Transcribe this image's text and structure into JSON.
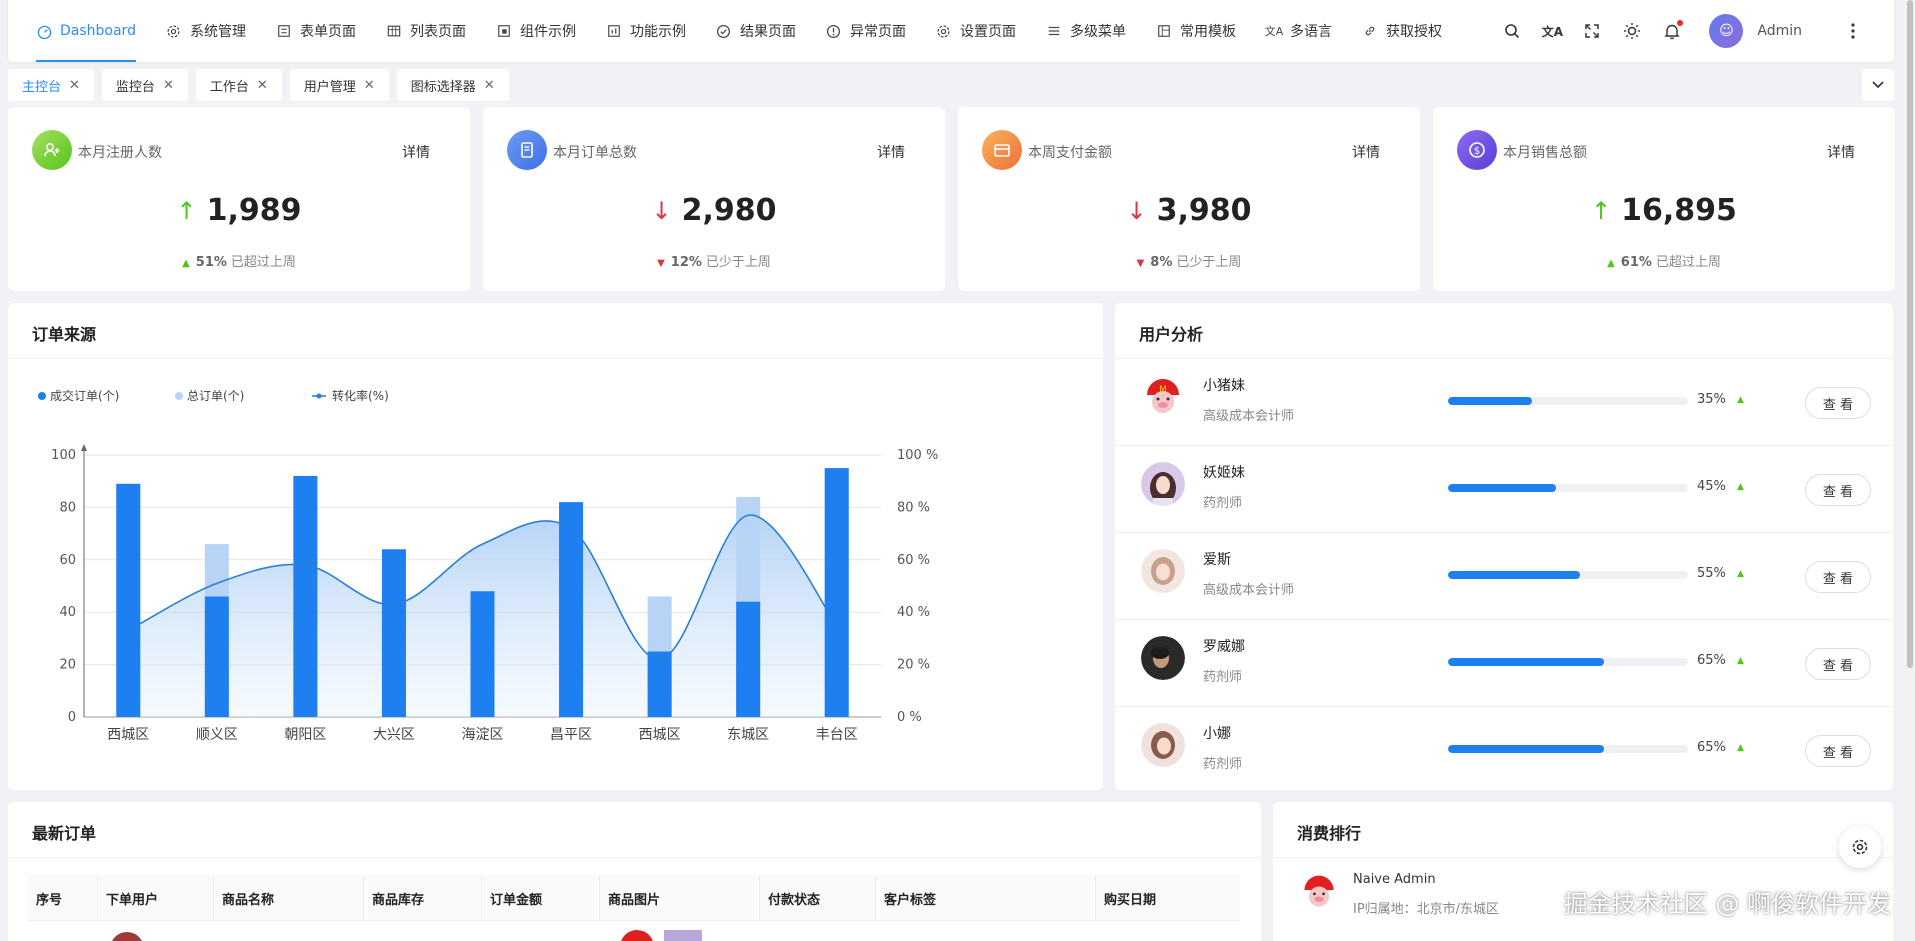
{
  "nav": {
    "items": [
      {
        "label": "Dashboard",
        "icon": "dashboard-icon"
      },
      {
        "label": "系统管理",
        "icon": "gear-icon"
      },
      {
        "label": "表单页面",
        "icon": "form-icon"
      },
      {
        "label": "列表页面",
        "icon": "table-icon"
      },
      {
        "label": "组件示例",
        "icon": "component-icon"
      },
      {
        "label": "功能示例",
        "icon": "feature-icon"
      },
      {
        "label": "结果页面",
        "icon": "check-circle-icon"
      },
      {
        "label": "异常页面",
        "icon": "warning-circle-icon"
      },
      {
        "label": "设置页面",
        "icon": "gear-icon"
      },
      {
        "label": "多级菜单",
        "icon": "menu-icon"
      },
      {
        "label": "常用模板",
        "icon": "template-icon"
      },
      {
        "label": "多语言",
        "icon": "translate-icon"
      },
      {
        "label": "获取授权",
        "icon": "link-icon"
      }
    ],
    "username": "Admin"
  },
  "tabs": [
    "主控台",
    "监控台",
    "工作台",
    "用户管理",
    "图标选择器"
  ],
  "stats": [
    {
      "label": "本月注册人数",
      "detail": "详情",
      "value": "1,989",
      "trend": "up",
      "percent": "51%",
      "compare": "已超过上周",
      "color": "#52c41a"
    },
    {
      "label": "本月订单总数",
      "detail": "详情",
      "value": "2,980",
      "trend": "down",
      "percent": "12%",
      "compare": "已少于上周",
      "color": "#4f7ff0"
    },
    {
      "label": "本周支付金额",
      "detail": "详情",
      "value": "3,980",
      "trend": "down",
      "percent": "8%",
      "compare": "已少于上周",
      "color": "#f0883a"
    },
    {
      "label": "本月销售总额",
      "detail": "详情",
      "value": "16,895",
      "trend": "up",
      "percent": "61%",
      "compare": "已超过上周",
      "color": "#6a4fe0"
    }
  ],
  "order_source": {
    "title": "订单来源"
  },
  "chart_data": {
    "type": "bar",
    "categories": [
      "西城区",
      "顺义区",
      "朝阳区",
      "大兴区",
      "海淀区",
      "昌平区",
      "西城区",
      "东城区",
      "丰台区"
    ],
    "series": [
      {
        "name": "成交订单(个)",
        "type": "bar",
        "values": [
          89,
          46,
          92,
          64,
          48,
          82,
          25,
          44,
          95
        ],
        "color": "#1e7ff0"
      },
      {
        "name": "总订单(个)",
        "type": "bar",
        "values": [
          89,
          66,
          92,
          64,
          48,
          82,
          46,
          84,
          95
        ],
        "color": "#b7d4f7"
      },
      {
        "name": "转化率(%)",
        "type": "line",
        "values": [
          33,
          51,
          58,
          43,
          66,
          72,
          22,
          77,
          35
        ],
        "color": "#2a80d6"
      }
    ],
    "ylim": [
      0,
      100
    ],
    "y_ticks": [
      "0",
      "20",
      "40",
      "60",
      "80",
      "100"
    ],
    "y2_ticks": [
      "0 %",
      "20 %",
      "40 %",
      "60 %",
      "80 %",
      "100 %"
    ],
    "legend_position": "top-left",
    "grid": true
  },
  "user_analysis": {
    "title": "用户分析",
    "button_label": "查 看",
    "users": [
      {
        "name": "小猪妹",
        "role": "高级成本会计师",
        "percent": 35,
        "percent_label": "35%"
      },
      {
        "name": "妖姬妹",
        "role": "药剂师",
        "percent": 45,
        "percent_label": "45%"
      },
      {
        "name": "爱斯",
        "role": "高级成本会计师",
        "percent": 55,
        "percent_label": "55%"
      },
      {
        "name": "罗威娜",
        "role": "药剂师",
        "percent": 65,
        "percent_label": "65%"
      },
      {
        "name": "小娜",
        "role": "药剂师",
        "percent": 65,
        "percent_label": "65%"
      }
    ]
  },
  "latest_orders": {
    "title": "最新订单",
    "columns": [
      "序号",
      "下单用户",
      "商品名称",
      "商品库存",
      "订单金额",
      "商品图片",
      "付款状态",
      "客户标签",
      "购买日期"
    ]
  },
  "ranking": {
    "title": "消费排行",
    "name": "Naive Admin",
    "ip": "IP归属地：北京市/东城区"
  },
  "watermark": "掘金技术社区 @ 啊俊软件开发"
}
